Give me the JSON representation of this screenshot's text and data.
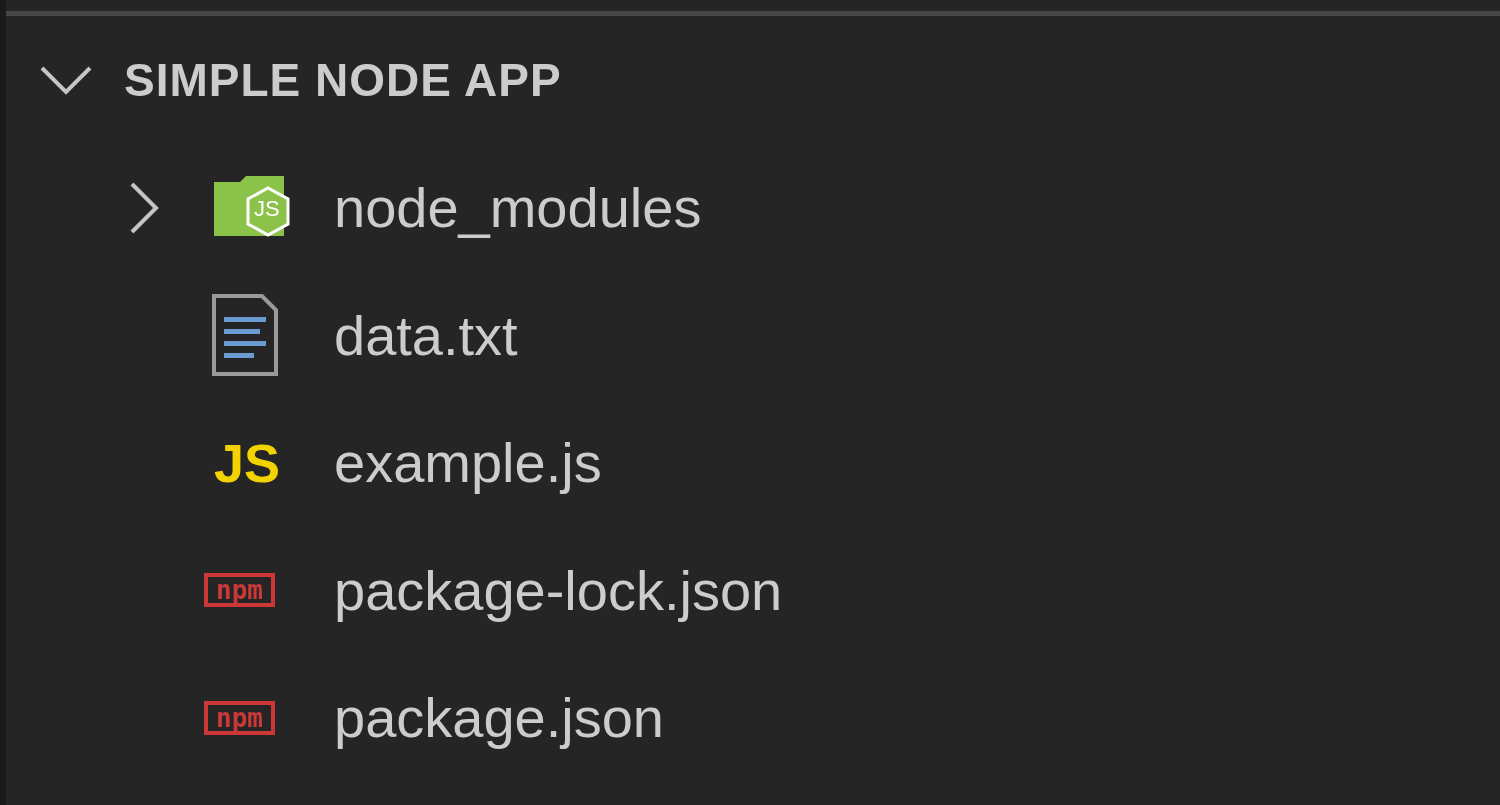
{
  "explorer": {
    "title": "SIMPLE NODE APP",
    "expanded": true,
    "items": [
      {
        "kind": "node-folder",
        "name": "node_modules",
        "expanded": false,
        "icon_label": "JS"
      },
      {
        "kind": "text",
        "name": "data.txt"
      },
      {
        "kind": "js",
        "name": "example.js",
        "icon_label": "JS"
      },
      {
        "kind": "npm",
        "name": "package-lock.json",
        "icon_label": "npm"
      },
      {
        "kind": "npm",
        "name": "package.json",
        "icon_label": "npm"
      }
    ]
  }
}
